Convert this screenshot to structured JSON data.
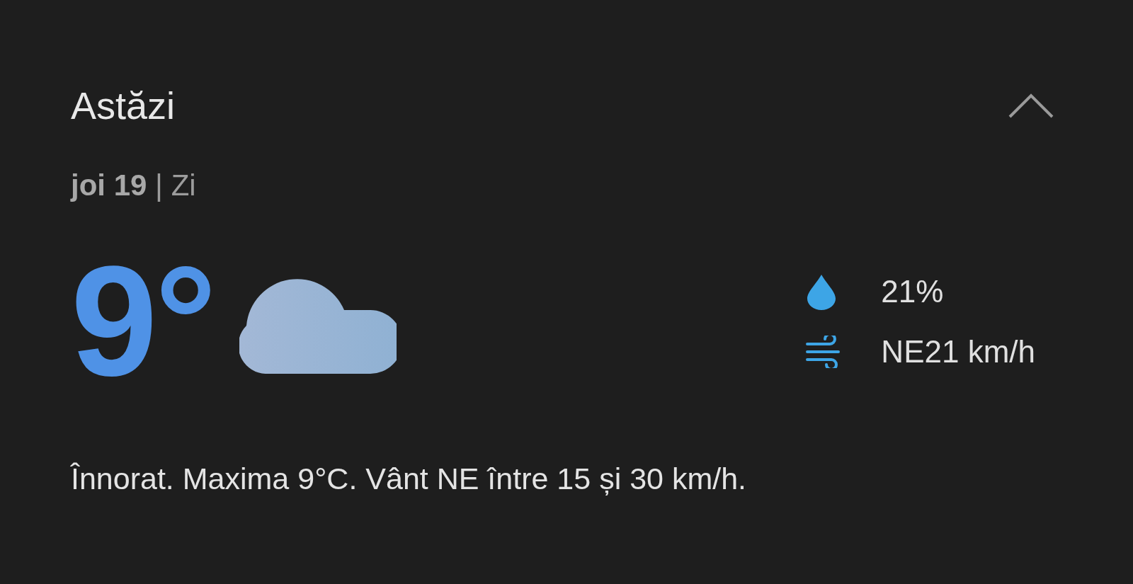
{
  "card": {
    "title": "Astăzi",
    "expanded": true,
    "subtitle": "**joi 19** | Zi",
    "temperature": "9°",
    "condition": {
      "kind": "cloudy"
    },
    "details": [
      {
        "kind": "precipitation",
        "value": "21%"
      },
      {
        "kind": "wind",
        "value": "NE21 km/h"
      }
    ],
    "description": "Înnorat. Maxima 9°C. Vânt NE între 15 și 30 km/h."
  }
}
